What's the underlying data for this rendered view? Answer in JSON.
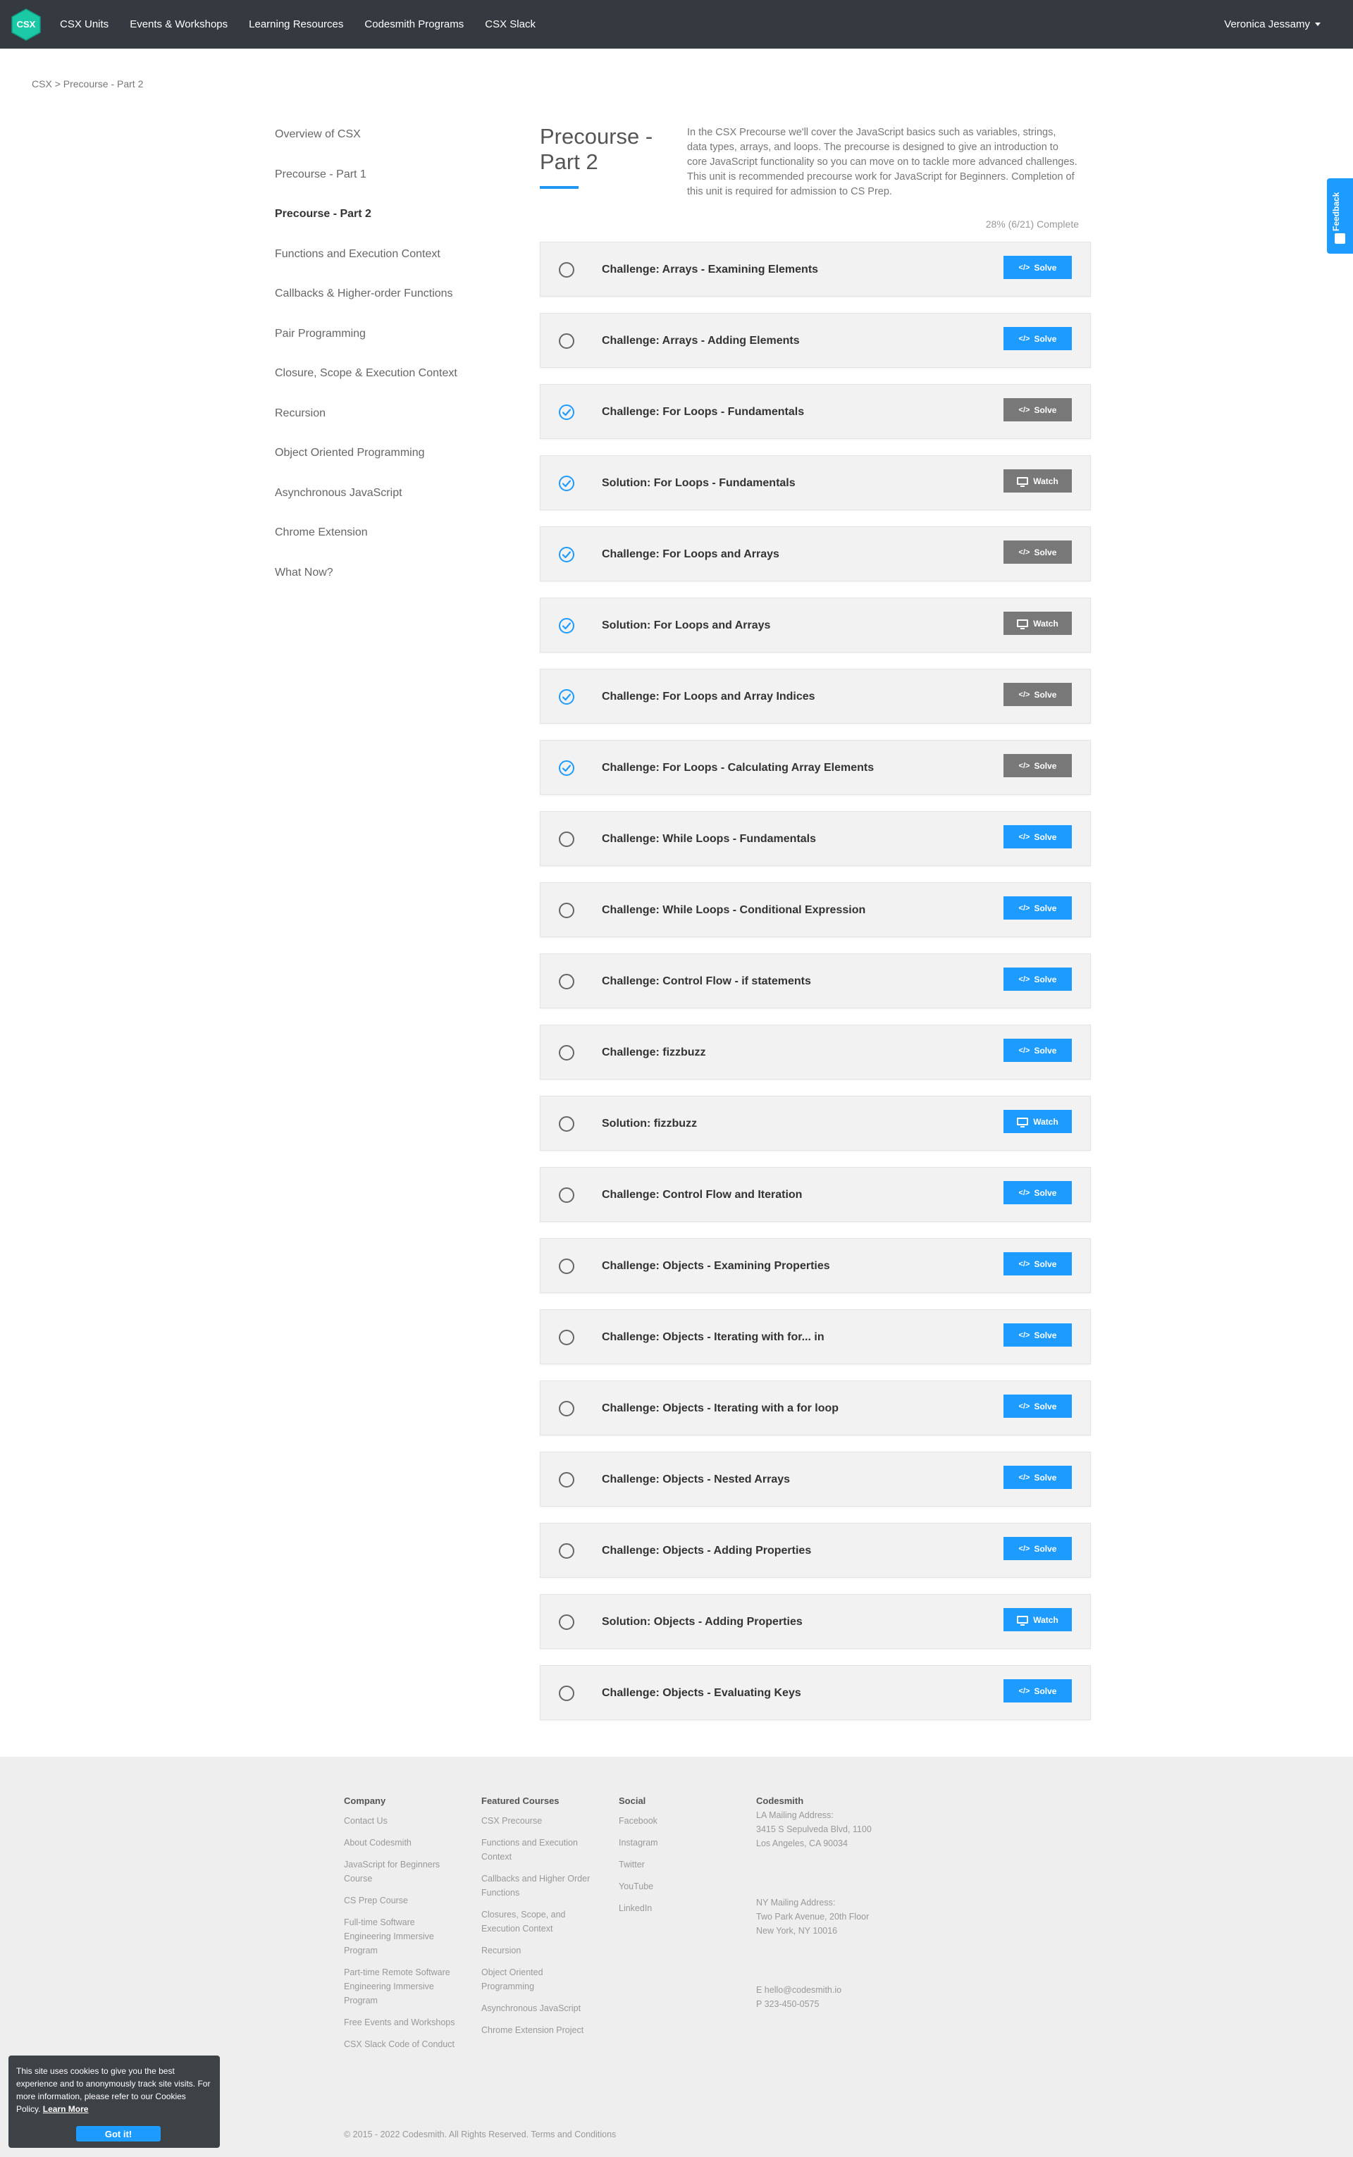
{
  "nav": {
    "logo_text": "CSX",
    "items": [
      "CSX Units",
      "Events & Workshops",
      "Learning Resources",
      "Codesmith Programs",
      "CSX Slack"
    ],
    "user": "Veronica Jessamy"
  },
  "breadcrumb": {
    "root": "CSX",
    "separator": ">",
    "current": "Precourse - Part 2"
  },
  "sidebar": {
    "items": [
      "Overview of CSX",
      "Precourse - Part 1",
      "Precourse - Part 2",
      "Functions and Execution Context",
      "Callbacks & Higher-order Functions",
      "Pair Programming",
      "Closure, Scope & Execution Context",
      "Recursion",
      "Object Oriented Programming",
      "Asynchronous JavaScript",
      "Chrome Extension",
      "What Now?"
    ],
    "active_index": 2
  },
  "unit": {
    "title": "Precourse - Part 2",
    "description": "In the CSX Precourse we'll cover the JavaScript basics such as variables, strings, data types, arrays, and loops. The precourse is designed to give an introduction to core JavaScript functionality so you can move on to tackle more advanced challenges. This unit is recommended precourse work for JavaScript for Beginners. Completion of this unit is required for admission to CS Prep.",
    "progress_text": "28% (6/21) Complete",
    "progress_fraction": 0.28
  },
  "challenges": [
    {
      "title": "Challenge: Arrays - Examining Elements",
      "done": false,
      "action": "Solve"
    },
    {
      "title": "Challenge: Arrays - Adding Elements",
      "done": false,
      "action": "Solve"
    },
    {
      "title": "Challenge: For Loops - Fundamentals",
      "done": true,
      "action": "Solve"
    },
    {
      "title": "Solution: For Loops - Fundamentals",
      "done": true,
      "action": "Watch"
    },
    {
      "title": "Challenge: For Loops and Arrays",
      "done": true,
      "action": "Solve"
    },
    {
      "title": "Solution: For Loops and Arrays",
      "done": true,
      "action": "Watch"
    },
    {
      "title": "Challenge: For Loops and Array Indices",
      "done": true,
      "action": "Solve"
    },
    {
      "title": "Challenge: For Loops - Calculating Array Elements",
      "done": true,
      "action": "Solve"
    },
    {
      "title": "Challenge: While Loops - Fundamentals",
      "done": false,
      "action": "Solve"
    },
    {
      "title": "Challenge: While Loops - Conditional Expression",
      "done": false,
      "action": "Solve"
    },
    {
      "title": "Challenge: Control Flow - if statements",
      "done": false,
      "action": "Solve"
    },
    {
      "title": "Challenge: fizzbuzz",
      "done": false,
      "action": "Solve"
    },
    {
      "title": "Solution: fizzbuzz",
      "done": false,
      "action": "Watch"
    },
    {
      "title": "Challenge: Control Flow and Iteration",
      "done": false,
      "action": "Solve"
    },
    {
      "title": "Challenge: Objects - Examining Properties",
      "done": false,
      "action": "Solve"
    },
    {
      "title": "Challenge: Objects - Iterating with for... in",
      "done": false,
      "action": "Solve"
    },
    {
      "title": "Challenge: Objects - Iterating with a for loop",
      "done": false,
      "action": "Solve"
    },
    {
      "title": "Challenge: Objects - Nested Arrays",
      "done": false,
      "action": "Solve"
    },
    {
      "title": "Challenge: Objects - Adding Properties",
      "done": false,
      "action": "Solve"
    },
    {
      "title": "Solution: Objects - Adding Properties",
      "done": false,
      "action": "Watch"
    },
    {
      "title": "Challenge: Objects - Evaluating Keys",
      "done": false,
      "action": "Solve"
    }
  ],
  "colors": {
    "accent": "#1e9bff",
    "completed_button": "#787878",
    "nav_bg": "#343a40",
    "check": "#1e9bff"
  },
  "footer": {
    "company": {
      "heading": "Company",
      "links": [
        "Contact Us",
        "About Codesmith",
        "JavaScript for Beginners Course",
        "CS Prep Course",
        "Full-time Software Engineering Immersive Program",
        "Part-time Remote Software Engineering Immersive Program",
        "Free Events and Workshops",
        "CSX Slack Code of Conduct"
      ]
    },
    "featured": {
      "heading": "Featured Courses",
      "links": [
        "CSX Precourse",
        "Functions and Execution Context",
        "Callbacks and Higher Order Functions",
        "Closures, Scope, and Execution Context",
        "Recursion",
        "Object Oriented Programming",
        "Asynchronous JavaScript",
        "Chrome Extension Project"
      ]
    },
    "social": {
      "heading": "Social",
      "links": [
        "Facebook",
        "Instagram",
        "Twitter",
        "YouTube",
        "LinkedIn"
      ]
    },
    "codesmith": {
      "heading": "Codesmith",
      "la_label": "LA Mailing Address:",
      "la_line1": "3415 S Sepulveda Blvd, 1100",
      "la_line2": "Los Angeles, CA 90034",
      "ny_label": "NY Mailing Address:",
      "ny_line1": "Two Park Avenue, 20th Floor",
      "ny_line2": "New York, NY 10016",
      "email": "E hello@codesmith.io",
      "phone": "P 323-450-0575"
    },
    "copyright": "© 2015 - 2022 Codesmith. All Rights Reserved.",
    "terms": "Terms and Conditions"
  },
  "feedback": {
    "label": "Feedback"
  },
  "cookie": {
    "text": "This site uses cookies to give you the best experience and to anonymously track site visits. For more information, please refer to our Cookies Policy.",
    "link": "Learn More",
    "button": "Got it!"
  }
}
